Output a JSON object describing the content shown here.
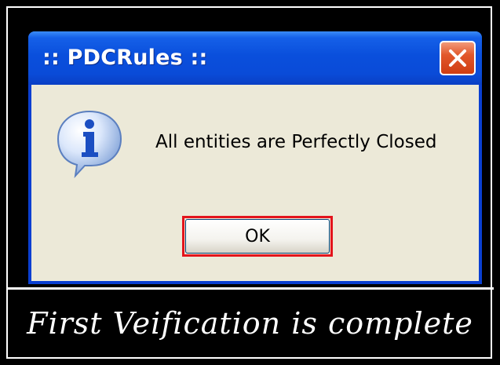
{
  "dialog": {
    "title": ":: PDCRules ::",
    "message": "All entities are Perfectly Closed",
    "ok_label": "OK",
    "icon": "info-icon",
    "close_icon": "close-icon"
  },
  "caption": {
    "text": "First Veification is complete"
  },
  "colors": {
    "titlebar": "#0a4fdc",
    "client_background": "#ece9d8",
    "close_button": "#e2572b",
    "highlight": "#e3141c",
    "frame": "#000000"
  }
}
